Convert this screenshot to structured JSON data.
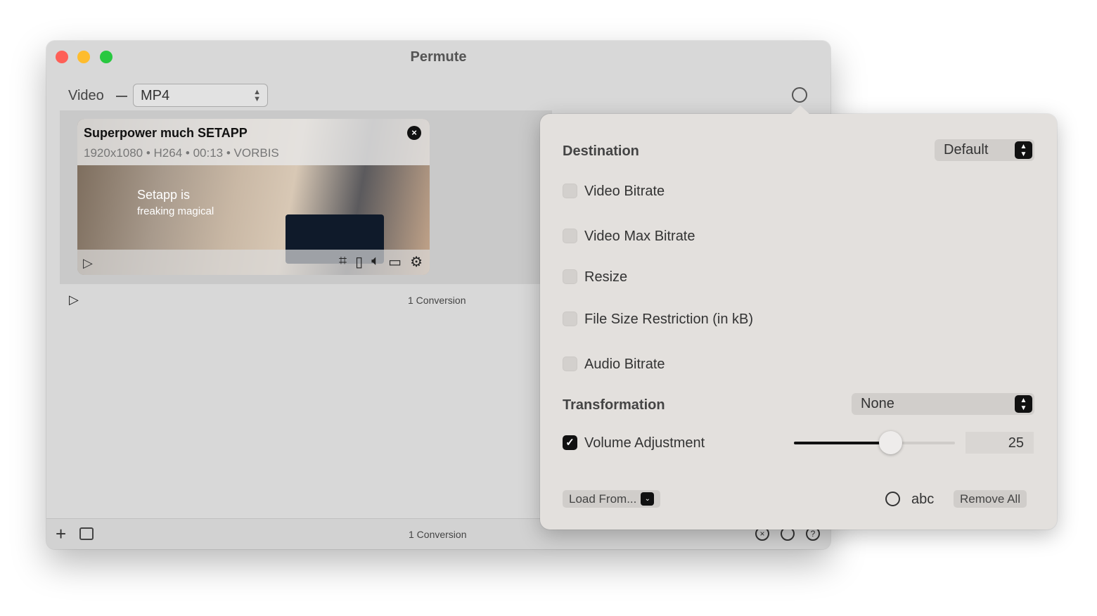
{
  "window": {
    "title": "Permute"
  },
  "toolbar": {
    "format_label": "Video",
    "format_value": "MP4"
  },
  "item": {
    "title": "Superpower much  SETAPP",
    "meta": "1920x1080 • H264 • 00:13 • VORBIS",
    "caption_line1": "Setapp is",
    "caption_line2": "freaking magical",
    "tools": [
      "crop-icon",
      "trim-icon",
      "audio-icon",
      "subtitles-icon",
      "settings-icon"
    ]
  },
  "list": {
    "conversion_count": "1 Conversion"
  },
  "statusbar": {
    "conversion_count": "1 Conversion"
  },
  "popover": {
    "destination_label": "Destination",
    "destination_value": "Default",
    "options": [
      {
        "label": "Video Bitrate",
        "checked": false
      },
      {
        "label": "Video Max Bitrate",
        "checked": false
      },
      {
        "label": "Resize",
        "checked": false
      },
      {
        "label": "File Size Restriction (in kB)",
        "checked": false
      },
      {
        "label": "Audio Bitrate",
        "checked": false
      }
    ],
    "transformation_label": "Transformation",
    "transformation_value": "None",
    "volume_label": "Volume Adjustment",
    "volume_checked": true,
    "volume_value": "25",
    "volume_slider_fraction": 0.6,
    "load_from": "Load From...",
    "abc": "abc",
    "remove_all": "Remove All"
  },
  "colors": {
    "close": "#fe5f57",
    "minimize": "#febc2e",
    "zoom": "#28c840"
  }
}
